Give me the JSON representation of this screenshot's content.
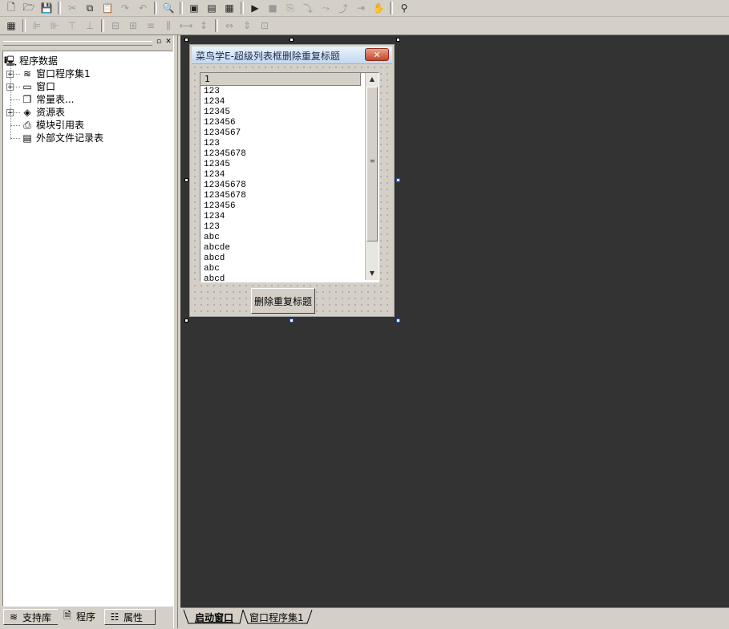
{
  "toolbar1": {
    "buttons": [
      {
        "name": "new-file-icon",
        "glyph": "🗋",
        "enabled": true
      },
      {
        "name": "open-folder-icon",
        "glyph": "🗁",
        "enabled": true
      },
      {
        "name": "save-icon",
        "glyph": "💾",
        "enabled": true
      },
      {
        "sep": true
      },
      {
        "name": "cut-icon",
        "glyph": "✂",
        "enabled": false
      },
      {
        "name": "copy-icon",
        "glyph": "⧉",
        "enabled": true
      },
      {
        "name": "paste-icon",
        "glyph": "📋",
        "enabled": false
      },
      {
        "name": "redo-icon",
        "glyph": "↷",
        "enabled": false
      },
      {
        "name": "undo-icon",
        "glyph": "↶",
        "enabled": false
      },
      {
        "sep": true
      },
      {
        "name": "find-icon",
        "glyph": "🔍",
        "enabled": true
      },
      {
        "sep": true
      },
      {
        "name": "layout-window-icon",
        "glyph": "▣",
        "enabled": true
      },
      {
        "name": "layout-horizontal-icon",
        "glyph": "▤",
        "enabled": true
      },
      {
        "name": "layout-grid-icon",
        "glyph": "▦",
        "enabled": true
      },
      {
        "sep": true
      },
      {
        "name": "run-icon",
        "glyph": "▶",
        "enabled": true
      },
      {
        "name": "stop-icon",
        "glyph": "■",
        "enabled": false
      },
      {
        "name": "step-icon",
        "glyph": "⎘",
        "enabled": false
      },
      {
        "name": "step-into-icon",
        "glyph": "⤵",
        "enabled": false
      },
      {
        "name": "step-over-icon",
        "glyph": "⤳",
        "enabled": false
      },
      {
        "name": "step-out-icon",
        "glyph": "⤴",
        "enabled": false
      },
      {
        "name": "run-to-cursor-icon",
        "glyph": "⇥",
        "enabled": false
      },
      {
        "name": "pause-hand-icon",
        "glyph": "✋",
        "enabled": false
      },
      {
        "sep": true
      },
      {
        "name": "debug-binoculars-icon",
        "glyph": "⚲",
        "enabled": true
      }
    ]
  },
  "toolbar2": {
    "buttons": [
      {
        "name": "form-layout-icon",
        "glyph": "▦",
        "enabled": true
      },
      {
        "sep": true
      },
      {
        "name": "align-left-icon",
        "glyph": "⊫",
        "enabled": false
      },
      {
        "name": "align-right-icon",
        "glyph": "⊪",
        "enabled": false
      },
      {
        "name": "align-top-icon",
        "glyph": "⊤",
        "enabled": false
      },
      {
        "name": "align-bottom-icon",
        "glyph": "⊥",
        "enabled": false
      },
      {
        "sep": true
      },
      {
        "name": "center-horizontal-icon",
        "glyph": "⊟",
        "enabled": false
      },
      {
        "name": "center-vertical-icon",
        "glyph": "⊞",
        "enabled": false
      },
      {
        "name": "distribute-top-icon",
        "glyph": "≡",
        "enabled": false
      },
      {
        "name": "distribute-middle-icon",
        "glyph": "⫼",
        "enabled": false
      },
      {
        "name": "space-horizontal-icon",
        "glyph": "⟷",
        "enabled": false
      },
      {
        "name": "space-vertical-icon",
        "glyph": "↕",
        "enabled": false
      },
      {
        "sep": true
      },
      {
        "name": "same-width-icon",
        "glyph": "⇔",
        "enabled": false
      },
      {
        "name": "same-height-icon",
        "glyph": "⇕",
        "enabled": false
      },
      {
        "name": "same-size-icon",
        "glyph": "⊡",
        "enabled": false
      }
    ]
  },
  "tree": {
    "root": "程序数据",
    "items": [
      {
        "label": "窗口程序集1",
        "icon": "stack-icon",
        "glyph": "≋",
        "expandable": true
      },
      {
        "label": "窗口",
        "icon": "window-icon",
        "glyph": "▭",
        "expandable": true
      },
      {
        "label": "常量表...",
        "icon": "cube-icon",
        "glyph": "❒",
        "expandable": false
      },
      {
        "label": "资源表",
        "icon": "resource-icon",
        "glyph": "◈",
        "expandable": true
      },
      {
        "label": "模块引用表",
        "icon": "module-icon",
        "glyph": "⎙",
        "expandable": false
      },
      {
        "label": "外部文件记录表",
        "icon": "file-icon",
        "glyph": "▤",
        "expandable": false
      }
    ]
  },
  "left_tabs": [
    "支持库",
    "程序",
    "属性"
  ],
  "form": {
    "title": "菜鸟学E-超级列表框删除重复标题",
    "close_glyph": "✕",
    "listbox": {
      "column_header": "1",
      "rows": [
        "123",
        "1234",
        "12345",
        "123456",
        "1234567",
        "123",
        "12345678",
        "12345",
        "1234",
        "12345678",
        "12345678",
        "123456",
        "1234",
        "123",
        "abc",
        "abcde",
        "abcd",
        "abc",
        "abcd"
      ]
    },
    "button_label": "删除重复标题"
  },
  "editor_tabs": [
    "启动窗口",
    "窗口程序集1"
  ]
}
